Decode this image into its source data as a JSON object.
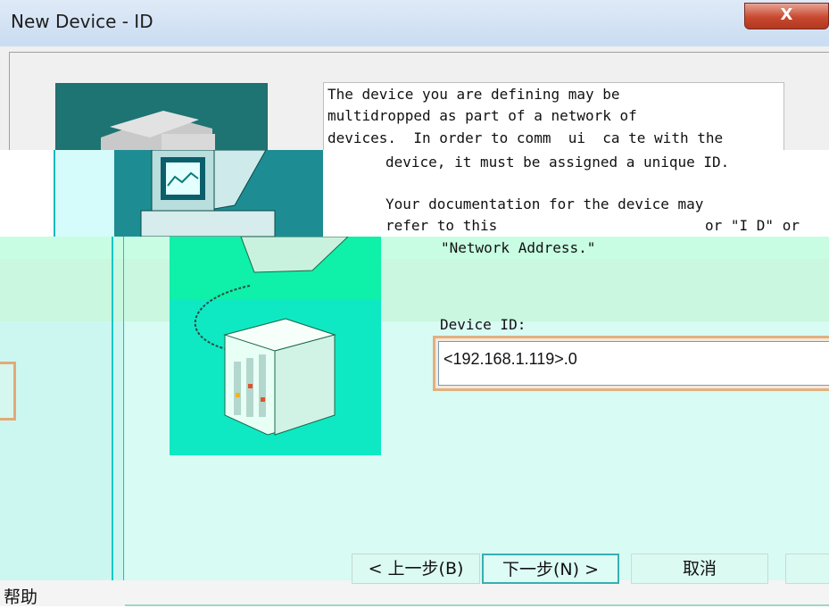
{
  "window": {
    "title": "New Device - ID",
    "close_glyph": "X"
  },
  "description": {
    "line1": "The device you are defining may be",
    "line2": "multidropped as part of a network of",
    "line3": "devices.  In order to comm  ui  ca te with the",
    "line4": "device, it must be assigned a unique ID.",
    "line5": "Your documentation for the device may",
    "line6": "refer to this",
    "line6b": "or \"I D\" or",
    "line7": "\"Network Address.\""
  },
  "form": {
    "device_id_label": "Device ID:",
    "device_id_value": "<192.168.1.119>.0"
  },
  "buttons": {
    "back": "< 上一步(B)",
    "next": "下一步(N) >",
    "cancel": "取消",
    "help": "帮助"
  },
  "icons": {
    "computer": "computer-icon",
    "server": "server-rack-icon"
  },
  "colors": {
    "close_button": "#c7492f",
    "field_border": "#e2b07f",
    "teal_illustration": "#1e7373"
  }
}
